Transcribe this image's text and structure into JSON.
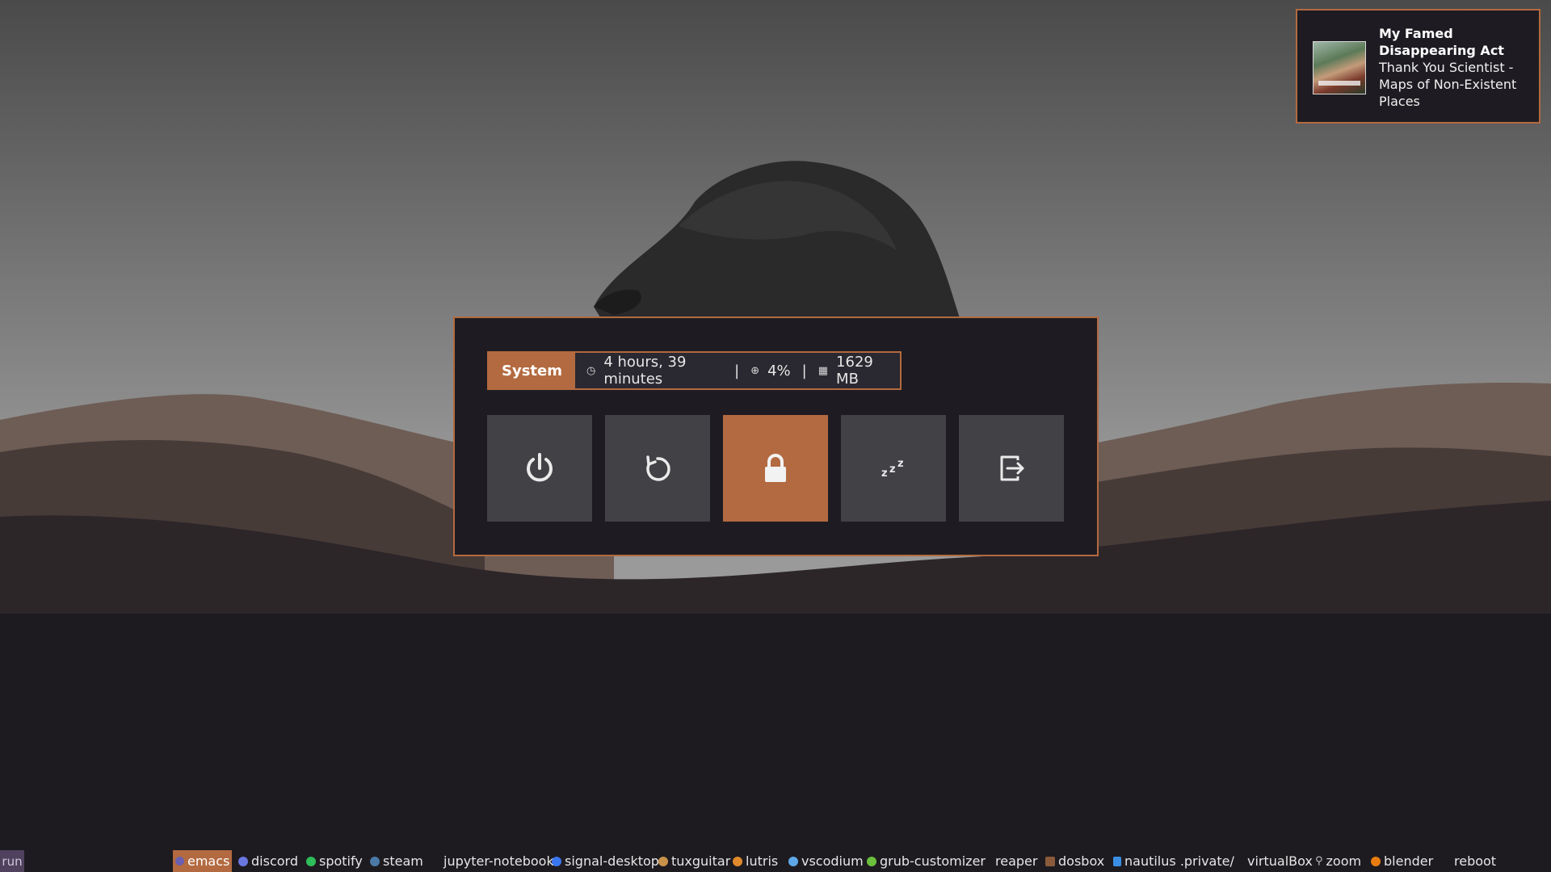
{
  "notification": {
    "title": "My Famed Disappearing Act",
    "body": "Thank You Scientist - Maps of Non-Existent Places"
  },
  "power_menu": {
    "label": "System",
    "uptime": "4 hours, 39 minutes",
    "cpu": "4%",
    "memory": "1629 MB",
    "separator": "|",
    "buttons": [
      {
        "name": "shutdown",
        "icon": "power-icon"
      },
      {
        "name": "reboot",
        "icon": "restart-icon"
      },
      {
        "name": "lock",
        "icon": "lock-icon",
        "selected": true
      },
      {
        "name": "suspend",
        "icon": "sleep-icon"
      },
      {
        "name": "logout",
        "icon": "logout-icon"
      }
    ]
  },
  "taskbar": {
    "run_label": "run",
    "items": [
      {
        "label": "emacs",
        "active": true
      },
      {
        "label": "discord"
      },
      {
        "label": "spotify"
      },
      {
        "label": "steam"
      },
      {
        "label": "jupyter-notebook"
      },
      {
        "label": "signal-desktop"
      },
      {
        "label": "tuxguitar"
      },
      {
        "label": "lutris"
      },
      {
        "label": "vscodium"
      },
      {
        "label": "grub-customizer"
      },
      {
        "label": "reaper"
      },
      {
        "label": "dosbox"
      },
      {
        "label": "nautilus .private/"
      },
      {
        "label": "virtualBox"
      },
      {
        "label": "zoom"
      },
      {
        "label": "blender"
      },
      {
        "label": "reboot"
      }
    ]
  },
  "colors": {
    "accent": "#b36a40",
    "panel_bg": "#1e1c22",
    "button_bg": "#424146"
  }
}
